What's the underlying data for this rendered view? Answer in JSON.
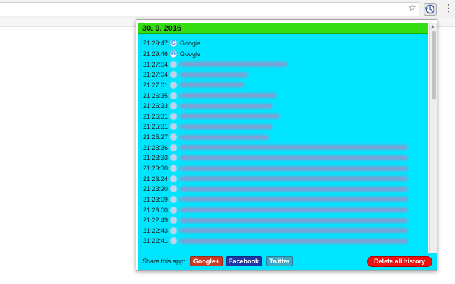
{
  "browser": {
    "star_glyph": "☆",
    "extension_icon": "history-clock-icon",
    "menu_glyph": "⋮"
  },
  "popup": {
    "date_header": "30. 9. 2016",
    "rows": [
      {
        "time": "21:29:47",
        "title": "Google",
        "favicon": "google-g-icon",
        "blurred": false
      },
      {
        "time": "21:29:46",
        "title": "Google",
        "favicon": "google-g-icon",
        "blurred": false
      },
      {
        "time": "21:27:04",
        "title": "",
        "favicon": "",
        "blurred": true
      },
      {
        "time": "21:27:04",
        "title": "",
        "favicon": "",
        "blurred": true
      },
      {
        "time": "21:27:01",
        "title": "",
        "favicon": "",
        "blurred": true
      },
      {
        "time": "21:26:35",
        "title": "",
        "favicon": "",
        "blurred": true
      },
      {
        "time": "21:26:33",
        "title": "",
        "favicon": "",
        "blurred": true
      },
      {
        "time": "21:26:31",
        "title": "",
        "favicon": "",
        "blurred": true
      },
      {
        "time": "21:25:31",
        "title": "",
        "favicon": "",
        "blurred": true
      },
      {
        "time": "21:25:27",
        "title": "",
        "favicon": "",
        "blurred": true
      },
      {
        "time": "21:23:36",
        "title": "",
        "favicon": "",
        "blurred": true
      },
      {
        "time": "21:23:33",
        "title": "",
        "favicon": "",
        "blurred": true
      },
      {
        "time": "21:23:30",
        "title": "",
        "favicon": "",
        "blurred": true
      },
      {
        "time": "21:23:24",
        "title": "",
        "favicon": "",
        "blurred": true
      },
      {
        "time": "21:23:20",
        "title": "",
        "favicon": "",
        "blurred": true
      },
      {
        "time": "21:23:09",
        "title": "",
        "favicon": "",
        "blurred": true
      },
      {
        "time": "21:23:00",
        "title": "",
        "favicon": "",
        "blurred": true
      },
      {
        "time": "21:22:49",
        "title": "",
        "favicon": "",
        "blurred": true
      },
      {
        "time": "21:22:43",
        "title": "",
        "favicon": "",
        "blurred": true
      },
      {
        "time": "21:22:41",
        "title": "",
        "favicon": "",
        "blurred": true
      }
    ],
    "share_label": "Share this app:",
    "google_plus_label": "Google+",
    "facebook_label": "Facebook",
    "twitter_label": "Twitter",
    "delete_all_label": "Delete all history"
  },
  "colors": {
    "list_background": "#00e5ff",
    "date_header_background": "#33dd11",
    "delete_button": "#ee1111",
    "google_plus": "#cc3b23",
    "facebook": "#1f38a8",
    "twitter": "#38a9c9"
  }
}
